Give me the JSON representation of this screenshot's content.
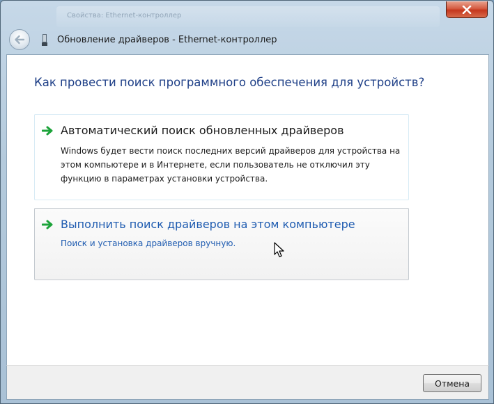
{
  "window": {
    "title": "Обновление драйверов - Ethernet-контроллер",
    "background_title": "Свойства: Ethernet-контроллер"
  },
  "nav": {
    "back_icon": "back-arrow-icon",
    "device_icon": "network-adapter-icon"
  },
  "main": {
    "heading": "Как провести поиск программного обеспечения для устройств?",
    "options": [
      {
        "title": "Автоматический поиск обновленных драйверов",
        "description": "Windows будет вести поиск последних версий драйверов для устройства на этом компьютере и в Интернете, если пользователь не отключил эту функцию в параметрах установки устройства.",
        "icon": "green-arrow-icon"
      },
      {
        "title": "Выполнить поиск драйверов на этом компьютере",
        "description": "Поиск и установка драйверов вручную.",
        "icon": "green-arrow-icon"
      }
    ]
  },
  "footer": {
    "cancel_label": "Отмена"
  },
  "colors": {
    "heading": "#1e3f87",
    "link": "#1e5bb0",
    "arrow": "#1ca33a",
    "close_button": "#c4371d"
  }
}
